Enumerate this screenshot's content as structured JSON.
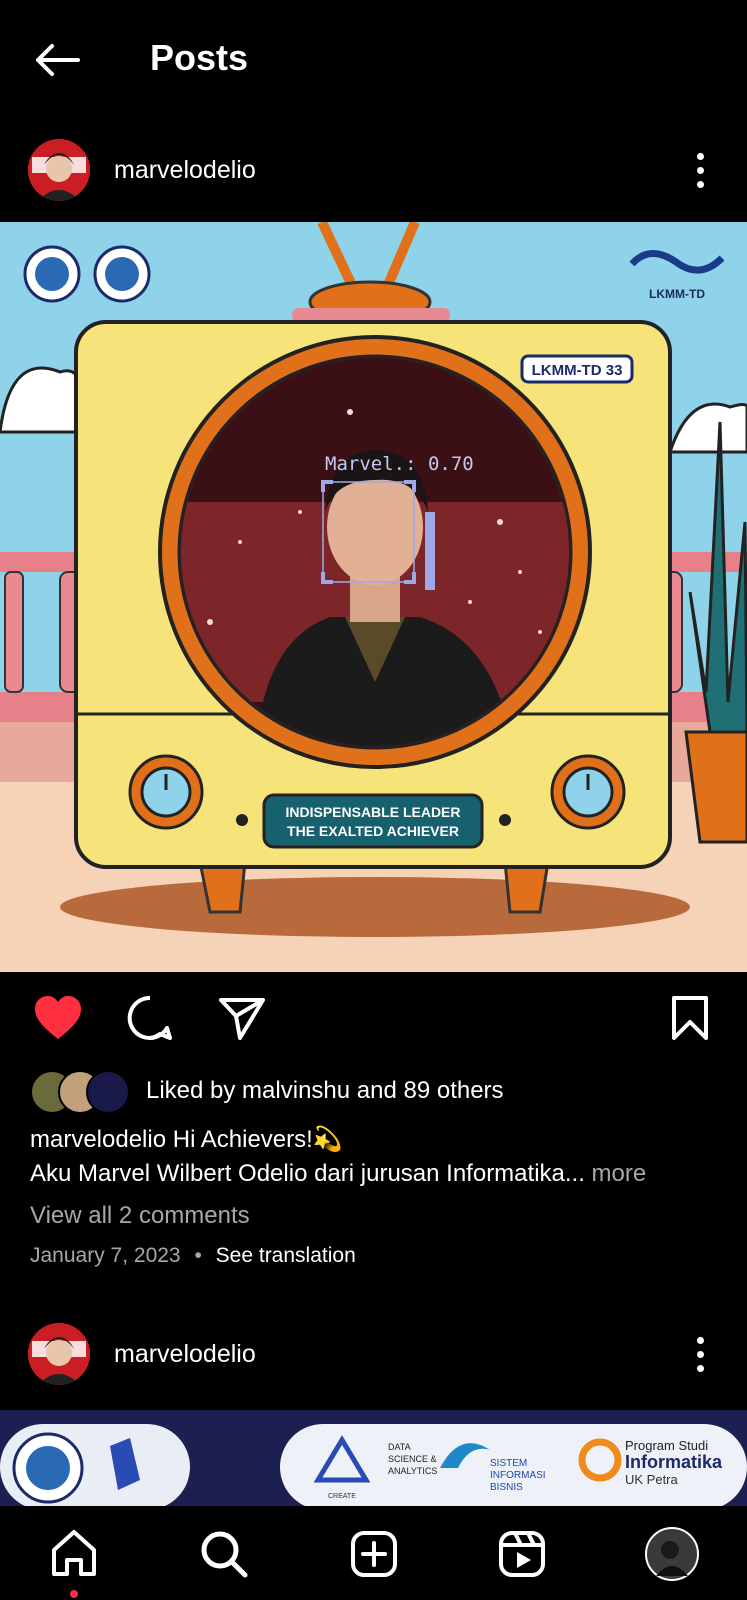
{
  "header": {
    "title": "Posts",
    "back_icon": "arrow-left-icon"
  },
  "post1": {
    "username": "marvelodelio",
    "image": {
      "badge": "LKMM-TD 33",
      "logo_text": "LKMM-TD",
      "detection_label": "Marvel.: 0.70",
      "banner_line1": "INDISPENSABLE LEADER",
      "banner_line2": "THE EXALTED ACHIEVER"
    },
    "liked": true,
    "likes_text": "Liked by malvinshu and 89 others",
    "caption_user": "marvelodelio",
    "caption_line1": "Hi Achievers!💫",
    "caption_line2": "Aku Marvel Wilbert Odelio dari jurusan Informatika...",
    "caption_more": " more",
    "view_comments": "View all 2 comments",
    "date": "January 7, 2023",
    "separator": "•",
    "see_translation": "See translation"
  },
  "post2": {
    "username": "marvelodelio",
    "banner": {
      "dsa_line1": "DATA",
      "dsa_line2": "SCIENCE &",
      "dsa_line3": "ANALYTICS",
      "create_text": "CREATE",
      "sib_line1": "SISTEM",
      "sib_line2": "INFORMASI",
      "sib_line3": "BISNIS",
      "inf_line1": "Program Studi",
      "inf_line2": "Informatika",
      "inf_line3": "UK Petra"
    }
  },
  "colors": {
    "accent_like": "#ff3040",
    "background": "#000000",
    "muted": "#a8a8a8"
  },
  "nav": [
    "home-icon",
    "search-icon",
    "create-icon",
    "reels-icon",
    "profile-icon"
  ]
}
